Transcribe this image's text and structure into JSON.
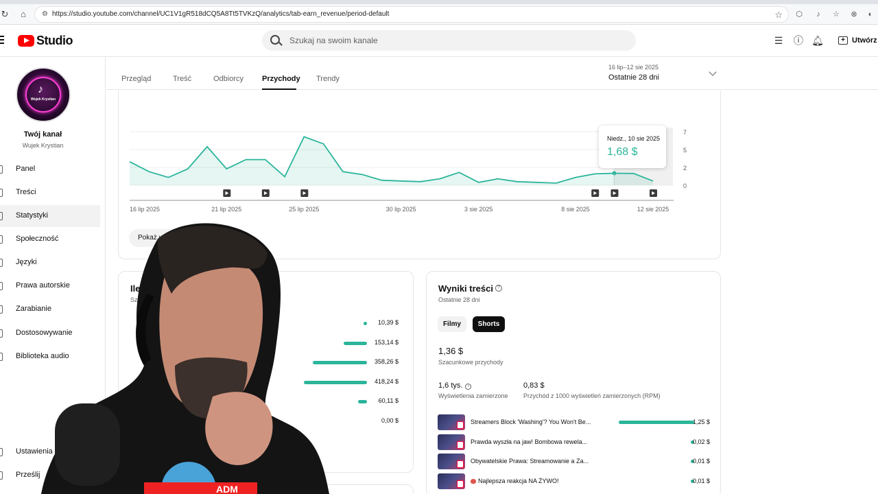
{
  "browser": {
    "url": "https://studio.youtube.com/channel/UC1V1gR518dCQ5A8Tt5TVKzQ/analytics/tab-earn_revenue/period-default"
  },
  "header": {
    "logo_text": "Studio",
    "search_placeholder": "Szukaj na swoim kanale",
    "create_label": "Utwórz"
  },
  "sidebar": {
    "channel_title": "Twój kanał",
    "channel_name": "Wujek Krystian",
    "avatar_caption": "Wujek Krystian",
    "items": [
      {
        "label": "Panel",
        "active": false
      },
      {
        "label": "Treści",
        "active": false
      },
      {
        "label": "Statystyki",
        "active": true
      },
      {
        "label": "Społeczność",
        "active": false
      },
      {
        "label": "Języki",
        "active": false
      },
      {
        "label": "Prawa autorskie",
        "active": false
      },
      {
        "label": "Zarabianie",
        "active": false
      },
      {
        "label": "Dostosowywanie",
        "active": false
      },
      {
        "label": "Biblioteka audio",
        "active": false
      }
    ],
    "bottom_items": [
      {
        "label": "Ustawienia"
      },
      {
        "label": "Prześlij"
      }
    ]
  },
  "tabs": [
    {
      "label": "Przegląd",
      "active": false
    },
    {
      "label": "Treść",
      "active": false
    },
    {
      "label": "Odbiorcy",
      "active": false
    },
    {
      "label": "Przychody",
      "active": true
    },
    {
      "label": "Trendy",
      "active": false
    }
  ],
  "period": {
    "range": "16 lip–12 sie 2025",
    "label": "Ostatnie 28 dni"
  },
  "chart_data": {
    "type": "area",
    "x": [
      "16 lip",
      "17 lip",
      "18 lip",
      "19 lip",
      "20 lip",
      "21 lip",
      "22 lip",
      "23 lip",
      "24 lip",
      "25 lip",
      "26 lip",
      "27 lip",
      "28 lip",
      "29 lip",
      "30 lip",
      "31 lip",
      "1 sie",
      "2 sie",
      "3 sie",
      "4 sie",
      "5 sie",
      "6 sie",
      "7 sie",
      "8 sie",
      "9 sie",
      "10 sie",
      "11 sie",
      "12 sie"
    ],
    "values": [
      3.3,
      1.9,
      1.1,
      2.3,
      5.4,
      2.3,
      3.6,
      3.6,
      1.2,
      6.8,
      5.8,
      1.9,
      1.5,
      0.7,
      0.6,
      0.5,
      0.9,
      1.8,
      0.4,
      0.9,
      0.5,
      0.4,
      0.3,
      1.1,
      1.6,
      1.68,
      1.65,
      0.6
    ],
    "x_tick_labels": [
      "16 lip 2025",
      "21 lip 2025",
      "25 lip 2025",
      "30 lip 2025",
      "3 sie 2025",
      "8 sie 2025",
      "12 sie 2025"
    ],
    "y_tick_labels": [
      "7,50 $",
      "5,00 $",
      "2,50 $",
      "0,00 $"
    ],
    "ylim": [
      0,
      8.5
    ],
    "grid": true,
    "color": "#2bb59a",
    "video_markers": [
      "21 lip",
      "23 lip",
      "25 lip",
      "9 sie",
      "10 sie",
      "12 sie"
    ],
    "tooltip": {
      "date": "Niedz., 10 sie 2025",
      "value": "1,68 $"
    }
  },
  "show_more_label": "Pokaż wi",
  "left_card": {
    "title": "Ile z",
    "subtitle": "Sza",
    "rows": [
      {
        "value": "10,39 $",
        "fraction": 0.0
      },
      {
        "value": "153,14 $",
        "fraction": 0.37
      },
      {
        "value": "358,26 $",
        "fraction": 0.86
      },
      {
        "value": "418,24 $",
        "fraction": 1.0
      },
      {
        "value": "60,11 $",
        "fraction": 0.14
      },
      {
        "value": "0,00 $",
        "fraction": null
      }
    ]
  },
  "right_card": {
    "title": "Wyniki treści",
    "subtitle": "Ostatnie 28 dni",
    "chip_films": "Filmy",
    "chip_shorts": "Shorts",
    "revenue_value": "1,36 $",
    "revenue_label": "Szacunkowe przychody",
    "views_value": "1,6 tys.",
    "views_label": "Wyświetlenia zamierzone",
    "rpm_value": "0,83 $",
    "rpm_label": "Przychód z 1000 wyświetleń zamierzonych (RPM)",
    "videos": [
      {
        "title": "Streamers Block 'Washing'? You Won't Be...",
        "value": "1,25 $",
        "fraction": 1.0,
        "emoji": false
      },
      {
        "title": "Prawda wyszła na jaw! Bombowa rewela...",
        "value": "0,02 $",
        "fraction": 0.0,
        "emoji": false
      },
      {
        "title": "Obywatelskie Prawa: Streamowanie a Za...",
        "value": "0,01 $",
        "fraction": 0.0,
        "emoji": false
      },
      {
        "title": "Najlepsza reakcja NA ŻYWO!",
        "value": "0,01 $",
        "fraction": 0.0,
        "emoji": true
      }
    ]
  },
  "webcam": {
    "shirt_text": "ADM"
  }
}
